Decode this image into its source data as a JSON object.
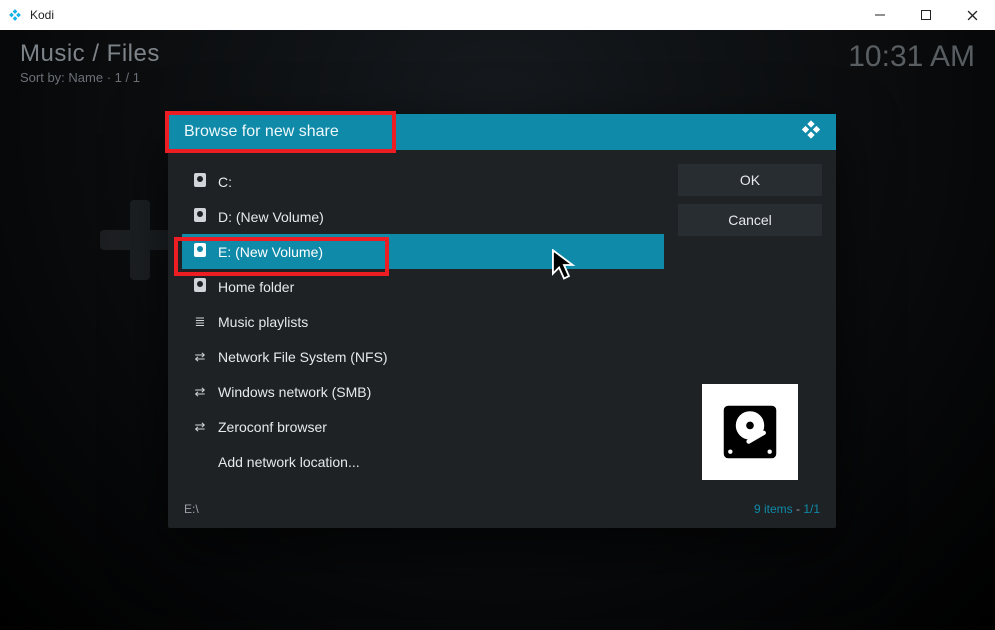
{
  "window": {
    "title": "Kodi"
  },
  "header": {
    "breadcrumb": "Music / Files",
    "sort_label": "Sort by: Name",
    "page_info": "1 / 1",
    "clock": "10:31 AM"
  },
  "dialog": {
    "title": "Browse for new share",
    "ok_label": "OK",
    "cancel_label": "Cancel",
    "path": "E:\\",
    "item_count_label": "9 items",
    "page_indicator": "1/1",
    "items": [
      {
        "label": "C:",
        "icon": "drive",
        "selected": false
      },
      {
        "label": "D: (New Volume)",
        "icon": "drive",
        "selected": false
      },
      {
        "label": "E: (New Volume)",
        "icon": "drive",
        "selected": true
      },
      {
        "label": "Home folder",
        "icon": "drive",
        "selected": false
      },
      {
        "label": "Music playlists",
        "icon": "playlist",
        "selected": false
      },
      {
        "label": "Network File System (NFS)",
        "icon": "network",
        "selected": false
      },
      {
        "label": "Windows network (SMB)",
        "icon": "network",
        "selected": false
      },
      {
        "label": "Zeroconf browser",
        "icon": "network",
        "selected": false
      },
      {
        "label": "Add network location...",
        "icon": "none",
        "selected": false
      }
    ]
  },
  "icons": {
    "drive": "💽",
    "playlist": "≣",
    "network": "⇄",
    "none": ""
  },
  "colors": {
    "accent": "#0f8aa8",
    "highlight": "#ec1e24"
  }
}
